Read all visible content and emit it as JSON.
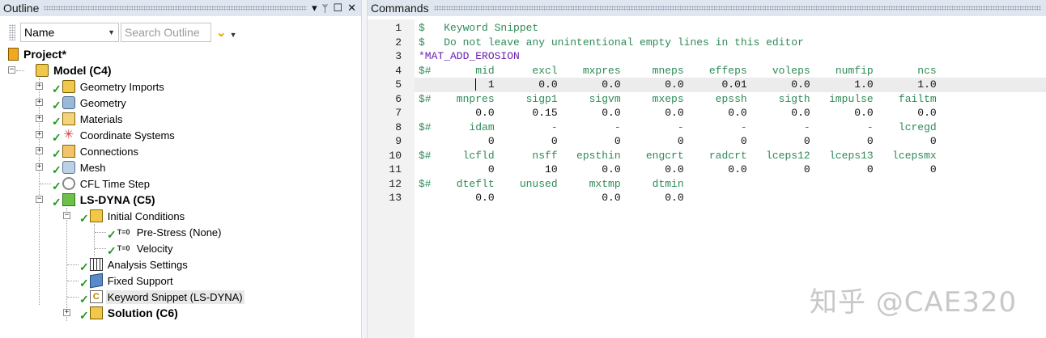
{
  "outline": {
    "title": "Outline",
    "title_icons": [
      "dropdown-icon",
      "pin-icon",
      "maximize-icon",
      "close-icon"
    ],
    "name_select": "Name",
    "search_placeholder": "Search Outline",
    "tree": [
      {
        "label": "Project*",
        "bold": true,
        "icon": "project-book-icon"
      },
      {
        "label": "Model (C4)",
        "bold": true,
        "icon": "model-icon",
        "expanded": true
      },
      {
        "label": "Geometry Imports",
        "icon": "geometry-imports-icon",
        "checked": true
      },
      {
        "label": "Geometry",
        "icon": "geometry-icon",
        "checked": true
      },
      {
        "label": "Materials",
        "icon": "materials-icon",
        "checked": true
      },
      {
        "label": "Coordinate Systems",
        "icon": "coordinate-systems-icon",
        "checked": true
      },
      {
        "label": "Connections",
        "icon": "connections-icon",
        "checked": true
      },
      {
        "label": "Mesh",
        "icon": "mesh-icon",
        "checked": true
      },
      {
        "label": "CFL Time Step",
        "icon": "clock-icon",
        "checked": true
      },
      {
        "label": "LS-DYNA (C5)",
        "bold": true,
        "icon": "ls-dyna-icon",
        "checked": true,
        "expanded": true
      },
      {
        "label": "Initial Conditions",
        "icon": "initial-conditions-icon",
        "checked": true,
        "expanded": true
      },
      {
        "label": "Pre-Stress (None)",
        "icon": "t0-icon",
        "checked": true
      },
      {
        "label": "Velocity",
        "icon": "t0-icon",
        "checked": true
      },
      {
        "label": "Analysis Settings",
        "icon": "analysis-settings-icon",
        "checked": true
      },
      {
        "label": "Fixed Support",
        "icon": "fixed-support-icon",
        "checked": true
      },
      {
        "label": "Keyword Snippet (LS-DYNA)",
        "icon": "keyword-snippet-icon",
        "checked": true,
        "selected": true
      },
      {
        "label": "Solution (C6)",
        "bold": true,
        "icon": "solution-icon",
        "checked": true
      }
    ]
  },
  "commands": {
    "title": "Commands",
    "lines": [
      {
        "n": "1",
        "text": "$   Keyword Snippet",
        "kind": "comment"
      },
      {
        "n": "2",
        "text": "$   Do not leave any unintentional empty lines in this editor",
        "kind": "comment"
      },
      {
        "n": "3",
        "text": "*MAT_ADD_EROSION",
        "kind": "keyword"
      },
      {
        "n": "4",
        "text": "$#       mid      excl    mxpres     mneps    effeps    voleps    numfip       ncs",
        "kind": "comment"
      },
      {
        "n": "5",
        "text": "           1       0.0       0.0       0.0      0.01       0.0       1.0       1.0",
        "kind": "plain",
        "active": true
      },
      {
        "n": "6",
        "text": "$#    mnpres     sigp1     sigvm     mxeps     epssh     sigth   impulse    failtm",
        "kind": "comment"
      },
      {
        "n": "7",
        "text": "         0.0      0.15       0.0       0.0       0.0       0.0       0.0       0.0",
        "kind": "plain"
      },
      {
        "n": "8",
        "text": "$#      idam         -         -         -         -         -         -    lcregd",
        "kind": "comment"
      },
      {
        "n": "9",
        "text": "           0         0         0         0         0         0         0         0",
        "kind": "plain"
      },
      {
        "n": "10",
        "text": "$#     lcfld      nsff   epsthin    engcrt    radcrt   lceps12   lceps13   lcepsmx",
        "kind": "comment"
      },
      {
        "n": "11",
        "text": "           0        10       0.0       0.0       0.0         0         0         0",
        "kind": "plain"
      },
      {
        "n": "12",
        "text": "$#    dteflt    unused     mxtmp     dtmin",
        "kind": "comment"
      },
      {
        "n": "13",
        "text": "         0.0                 0.0       0.0",
        "kind": "plain"
      }
    ]
  },
  "watermark": "知乎 @CAE320",
  "colors": {
    "comment": "#2e8b57",
    "keyword": "#6a1fb0",
    "check": "#1c9a1c",
    "title_bar": "#dfe6ef"
  }
}
